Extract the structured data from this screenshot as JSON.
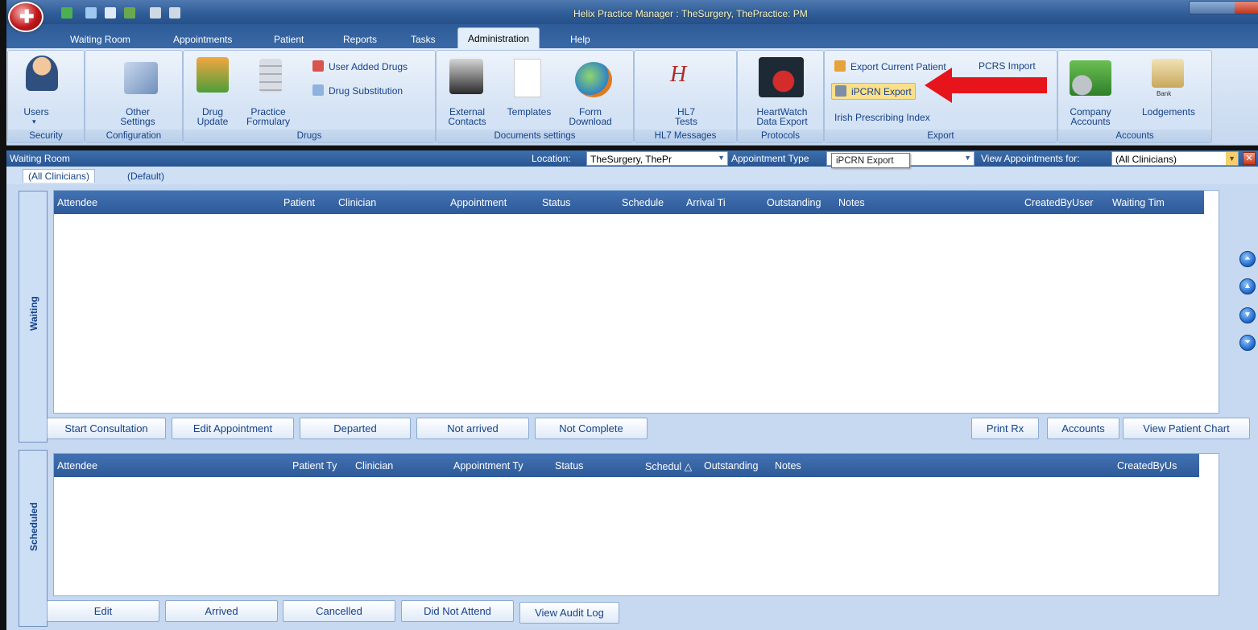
{
  "window": {
    "title": "Helix Practice Manager : TheSurgery, ThePractice: PM"
  },
  "tabs": [
    {
      "label": "Waiting Room"
    },
    {
      "label": "Appointments"
    },
    {
      "label": "Patient"
    },
    {
      "label": "Reports"
    },
    {
      "label": "Tasks"
    },
    {
      "label": "Administration"
    },
    {
      "label": "Help"
    }
  ],
  "ribbon": {
    "security": {
      "group_label": "Security",
      "users": "Users"
    },
    "configuration": {
      "group_label": "Configuration",
      "other_settings_line1": "Other",
      "other_settings_line2": "Settings"
    },
    "drugs": {
      "group_label": "Drugs",
      "drug_update_line1": "Drug",
      "drug_update_line2": "Update",
      "practice_formulary_line1": "Practice",
      "practice_formulary_line2": "Formulary",
      "user_added_drugs": "User Added Drugs",
      "drug_substitution": "Drug Substitution"
    },
    "documents": {
      "group_label": "Documents settings",
      "external_contacts_line1": "External",
      "external_contacts_line2": "Contacts",
      "templates": "Templates",
      "form_download_line1": "Form",
      "form_download_line2": "Download"
    },
    "hl7": {
      "group_label": "HL7 Messages",
      "hl7_tests_line1": "HL7",
      "hl7_tests_line2": "Tests"
    },
    "protocols": {
      "group_label": "Protocols",
      "heartwatch_line1": "HeartWatch",
      "heartwatch_line2": "Data Export"
    },
    "export": {
      "group_label": "Export",
      "export_current_patient": "Export Current Patient",
      "pcrs_import": "PCRS Import",
      "ipcrn_export": "iPCRN Export",
      "irish_prescribing_index": "Irish Prescribing Index"
    },
    "accounts": {
      "group_label": "Accounts",
      "company_accounts_line1": "Company",
      "company_accounts_line2": "Accounts",
      "lodgements": "Lodgements",
      "bank": "Bank"
    }
  },
  "waiting_room_bar": {
    "title": "Waiting Room",
    "location_label": "Location:",
    "location_value": "TheSurgery, ThePr",
    "appointment_type_label": "Appointment Type",
    "tooltip": "iPCRN Export",
    "view_for_label": "View Appointments for:",
    "view_for_value": "(All Clinicians)"
  },
  "filter_tabs": [
    {
      "label": "(All Clinicians)"
    },
    {
      "label": "(Default)"
    }
  ],
  "waiting": {
    "side_label": "Waiting",
    "columns": [
      "Attendee",
      "Patient",
      "Clinician",
      "Appointment",
      "Status",
      "Schedule",
      "Arrival Ti",
      "Outstanding",
      "Notes",
      "CreatedByUser",
      "Waiting Tim"
    ],
    "buttons": {
      "start_consultation": "Start Consultation",
      "edit_appointment": "Edit Appointment",
      "departed": "Departed",
      "not_arrived": "Not arrived",
      "not_complete": "Not Complete",
      "print_rx": "Print Rx",
      "accounts": "Accounts",
      "view_patient_chart": "View Patient Chart"
    }
  },
  "scheduled": {
    "side_label": "Scheduled",
    "columns": [
      "Attendee",
      "Patient Ty",
      "Clinician",
      "Appointment Ty",
      "Status",
      "Schedul △",
      "Outstanding",
      "Notes",
      "CreatedByUs"
    ],
    "buttons": {
      "edit": "Edit",
      "arrived": "Arrived",
      "cancelled": "Cancelled",
      "did_not_attend": "Did Not Attend",
      "view_audit_log": "View Audit Log"
    }
  },
  "colors": {
    "accent": "#2d5a98",
    "arrow": "#e8141c",
    "highlight": "#fbe08a"
  }
}
